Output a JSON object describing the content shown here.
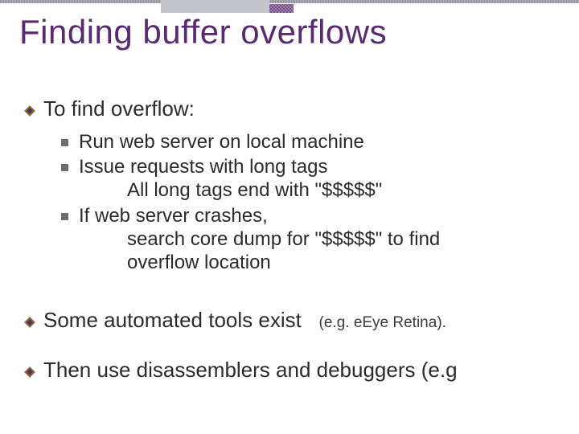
{
  "slide": {
    "title": "Finding buffer overflows",
    "section1": {
      "heading": "To find overflow:",
      "items": [
        {
          "line1": "Run web server on local machine"
        },
        {
          "line1": "Issue requests with long tags",
          "line2": "All long tags end with   \"$$$$$\""
        },
        {
          "line1": "If web server crashes,",
          "line2": "search core dump for  \"$$$$$\" to find",
          "line3": "overflow location"
        }
      ]
    },
    "section2": {
      "heading": "Some automated tools exist",
      "note": "(e.g.  eEye Retina)."
    },
    "section3": {
      "heading": "Then use disassemblers and debuggers (e.g"
    }
  }
}
